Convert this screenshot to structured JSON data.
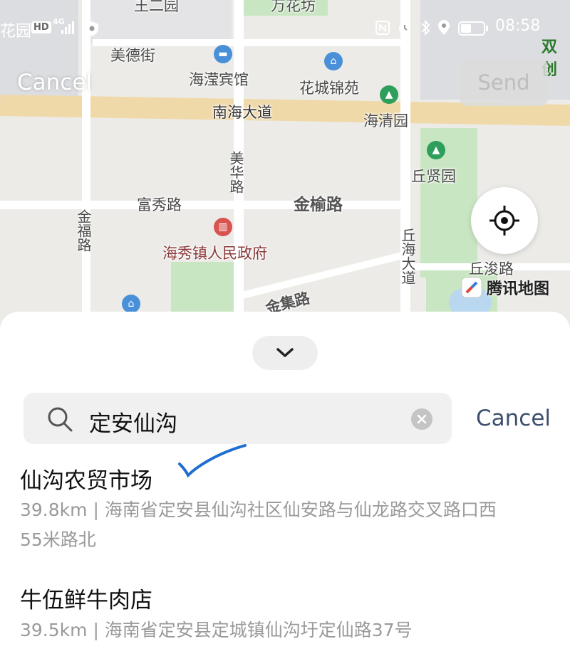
{
  "status_bar": {
    "left_text": "花园",
    "hd": "HD",
    "network": "4G",
    "time": "08:58",
    "right_text": "双创"
  },
  "top_bar": {
    "cancel_label": "Cancel",
    "send_label": "Send"
  },
  "map": {
    "labels": {
      "meide": "美德街",
      "hotel": "海滢宾馆",
      "huacheng": "花城锦苑",
      "nanhai": "南海大道",
      "haiqing": "海清园",
      "qiuxian": "丘贤园",
      "meihua": "美华路",
      "fuxiu": "富秀路",
      "jinyu": "金榆路",
      "jinfu": "金福路",
      "gov": "海秀镇人民政府",
      "qiuhai": "丘海大道",
      "qiujun": "丘浚路",
      "jinji": "金集路",
      "top_partial": "万花坊",
      "top_partial_left": "王二园"
    },
    "provider": "腾讯地图"
  },
  "search": {
    "query": "定安仙沟",
    "cancel_label": "Cancel"
  },
  "results": [
    {
      "title": "仙沟农贸市场",
      "address": "39.8km | 海南省定安县仙沟社区仙安路与仙龙路交叉路口西55米路北"
    },
    {
      "title": "牛伍鲜牛肉店",
      "address": "39.5km | 海南省定安县定城镇仙沟圩定仙路37号"
    }
  ],
  "colors": {
    "checkmark": "#1e6fd0",
    "gov_pin": "#d9534f",
    "park_pin": "#2e9e5b",
    "poi_pin": "#4a90d9"
  }
}
